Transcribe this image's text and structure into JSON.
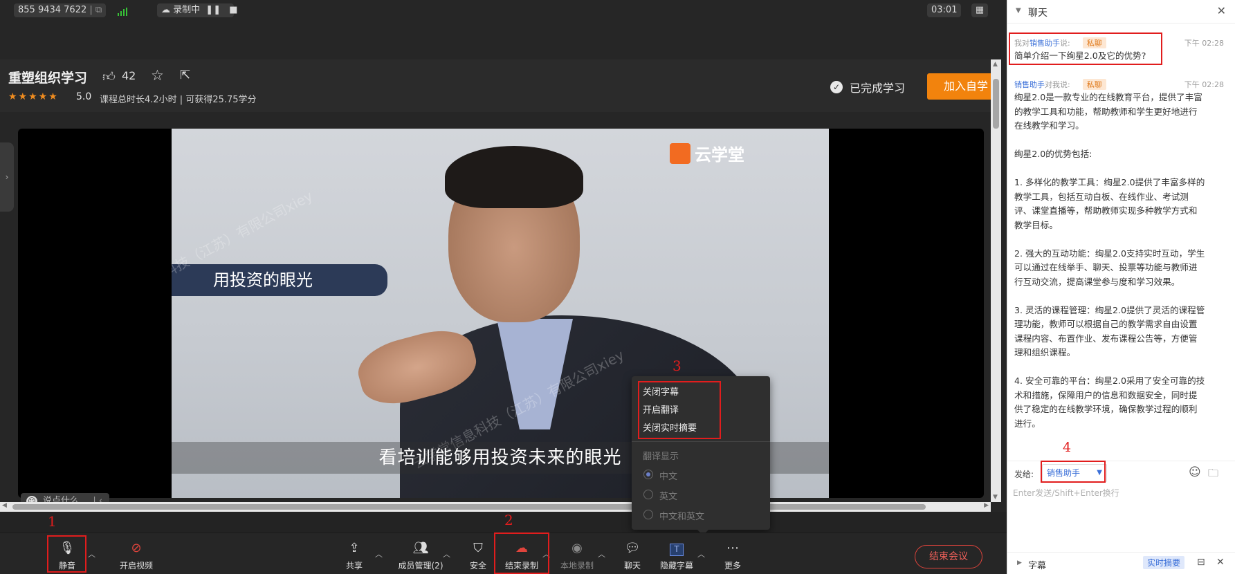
{
  "topbar": {
    "meeting_id": "855 9434 7622",
    "recording_label": "录制中",
    "timer": "03:01"
  },
  "course": {
    "title": "重塑组织学习",
    "likes": "42",
    "rating": "5.0",
    "meta": "课程总时长4.2小时 | 可获得25.75学分",
    "completed_label": "已完成学习",
    "join_button": "加入自学"
  },
  "video": {
    "banner_text": "用投资的眼光",
    "brand": "云学堂",
    "subtitle": "看培训能够用投资未来的眼光",
    "watermark_1": "云学堂信息科技（江苏）有限公司xiey",
    "watermark_2": "云学堂信息科技（江苏）有限公司xiey",
    "watermark_3": "信息科技（江苏）有限公司xiey",
    "comment_placeholder": "说点什么..."
  },
  "annotations": [
    "1",
    "2",
    "3",
    "4"
  ],
  "popup": {
    "items": [
      "关闭字幕",
      "开启翻译",
      "关闭实时摘要"
    ],
    "section_label": "翻译显示",
    "options": [
      "中文",
      "英文",
      "中文和英文"
    ],
    "selected_option": "中文"
  },
  "toolbar": {
    "mute": "静音",
    "video": "开启视频",
    "share": "共享",
    "members": "成员管理(2)",
    "security": "安全",
    "end_recording": "结束录制",
    "local_recording": "本地录制",
    "chat": "聊天",
    "hide_captions": "隐藏字幕",
    "more": "更多",
    "end_meeting": "结束会议"
  },
  "chat": {
    "title": "聊天",
    "messages": [
      {
        "prefix": "我对",
        "user": "销售助手",
        "suffix": "说:",
        "tag": "私聊",
        "time": "下午 02:28",
        "text": "简单介绍一下绚星2.0及它的优势?"
      },
      {
        "prefix": "",
        "user": "销售助手",
        "suffix": "对我说:",
        "tag": "私聊",
        "time": "下午 02:28",
        "text": "绚星2.0是一款专业的在线教育平台，提供了丰富的教学工具和功能，帮助教师和学生更好地进行在线教学和学习。\n\n绚星2.0的优势包括:\n\n1. 多样化的教学工具：绚星2.0提供了丰富多样的教学工具，包括互动白板、在线作业、考试测评、课堂直播等，帮助教师实现多种教学方式和教学目标。\n\n2. 强大的互动功能：绚星2.0支持实时互动，学生可以通过在线举手、聊天、投票等功能与教师进行互动交流，提高课堂参与度和学习效果。\n\n3. 灵活的课程管理：绚星2.0提供了灵活的课程管理功能，教师可以根据自己的教学需求自由设置课程内容、布置作业、发布课程公告等，方便管理和组织课程。\n\n4. 安全可靠的平台：绚星2.0采用了安全可靠的技术和措施，保障用户的信息和数据安全，同时提供了稳定的在线教学环境，确保教学过程的顺利进行。"
      }
    ],
    "send_label": "发给:",
    "recipient": "销售助手",
    "input_placeholder": "Enter发送/Shift+Enter换行",
    "caption_label": "字幕",
    "summary_button": "实时摘要"
  },
  "colors": {
    "accent_orange": "#f2830d",
    "annotation_red": "#e11d1d",
    "link_blue": "#3a6fd8",
    "end_red": "#e0443c"
  }
}
